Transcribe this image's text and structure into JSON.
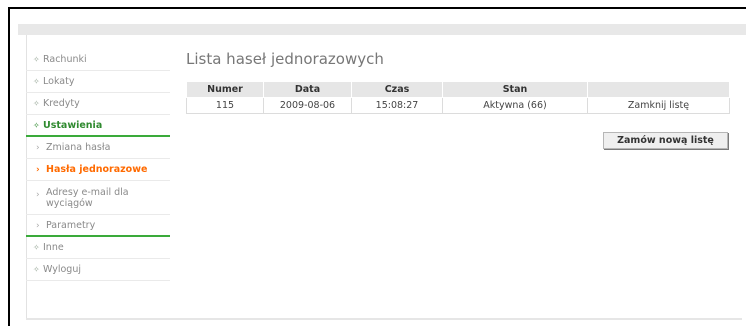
{
  "sidebar": {
    "items": [
      {
        "label": "Rachunki"
      },
      {
        "label": "Lokaty"
      },
      {
        "label": "Kredyty"
      },
      {
        "label": "Ustawienia"
      },
      {
        "label": "Zmiana hasła"
      },
      {
        "label": "Hasła jednorazowe"
      },
      {
        "label": "Adresy e-mail dla wyciągów"
      },
      {
        "label": "Parametry"
      },
      {
        "label": "Inne"
      },
      {
        "label": "Wyloguj"
      }
    ]
  },
  "main": {
    "title": "Lista haseł jednorazowych",
    "table": {
      "headers": [
        "Numer",
        "Data",
        "Czas",
        "Stan",
        ""
      ],
      "rows": [
        [
          "115",
          "2009-08-06",
          "15:08:27",
          "Aktywna (66)",
          "Zamknij listę"
        ]
      ]
    },
    "order_button": "Zamów nową listę"
  },
  "colors": {
    "accent_green": "#3aaa3a",
    "active_orange": "#ff6a00",
    "header_gray": "#e6e6e6"
  },
  "icons": {
    "top_item": "diamond-bullet-icon",
    "sub_item": "chevron-right-icon"
  }
}
